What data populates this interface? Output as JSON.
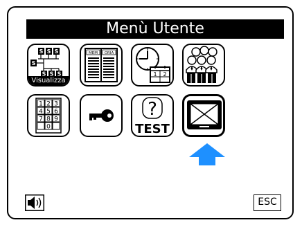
{
  "header": {
    "title": "Menù Utente"
  },
  "tiles": [
    {
      "icon": "network-display-icon",
      "label": "Visualizza"
    },
    {
      "icon": "memoria-book-icon",
      "book_text_left": "MEM",
      "book_text_right": "ORIA"
    },
    {
      "icon": "clock-calendar-icon",
      "calendar_text": "1 2"
    },
    {
      "icon": "users-group-icon"
    },
    {
      "icon": "keypad-icon",
      "keys": [
        "1",
        "2",
        "3",
        "4",
        "5",
        "6",
        "7",
        "8",
        "9",
        "0"
      ]
    },
    {
      "icon": "key-icon"
    },
    {
      "icon": "test-icon",
      "label_text": "TEST",
      "question_mark": "?"
    },
    {
      "icon": "monitor-icon"
    }
  ],
  "selection_arrow": {
    "icon": "up-arrow-icon",
    "color": "#1e90ff"
  },
  "footer": {
    "speaker_icon": "speaker-icon",
    "esc_label": "ESC"
  },
  "colors": {
    "accent": "#1e90ff",
    "foreground": "#000000",
    "background": "#ffffff"
  }
}
